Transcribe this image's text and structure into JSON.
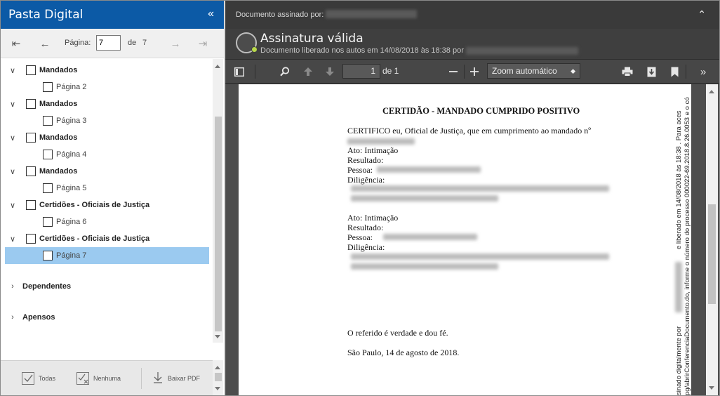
{
  "left_panel": {
    "title": "Pasta Digital",
    "collapse_icon": "double-chevron-left-icon",
    "pager": {
      "page_label": "Página:",
      "current_page": "7",
      "of_label": "de",
      "total_pages": "7"
    },
    "tree": [
      {
        "type": "group",
        "label": "Mandados"
      },
      {
        "type": "page",
        "label": "Página 2"
      },
      {
        "type": "group",
        "label": "Mandados"
      },
      {
        "type": "page",
        "label": "Página 3"
      },
      {
        "type": "group",
        "label": "Mandados"
      },
      {
        "type": "page",
        "label": "Página 4"
      },
      {
        "type": "group",
        "label": "Mandados"
      },
      {
        "type": "page",
        "label": "Página 5"
      },
      {
        "type": "group",
        "label": "Certidões - Oficiais de Justiça"
      },
      {
        "type": "page",
        "label": "Página 6"
      },
      {
        "type": "group",
        "label": "Certidões - Oficiais de Justiça"
      },
      {
        "type": "page",
        "label": "Página 7",
        "selected": true
      }
    ],
    "sections": [
      {
        "label": "Dependentes"
      },
      {
        "label": "Apensos"
      }
    ],
    "footer": {
      "all_label": "Todas",
      "none_label": "Nenhuma",
      "download_label": "Baixar PDF"
    }
  },
  "signature": {
    "signed_by_label": "Documento assinado por:",
    "status_title": "Assinatura válida",
    "released_text": "Documento liberado nos autos em 14/08/2018 às 18:38 por"
  },
  "viewer_toolbar": {
    "page_value": "1",
    "of_text": "de 1",
    "zoom_label": "Zoom automático"
  },
  "document": {
    "title": "CERTIDÃO - MANDADO CUMPRIDO POSITIVO",
    "intro": "CERTIFICO eu, Oficial de Justiça, que em cumprimento ao mandado nº",
    "block1": {
      "ato": "Ato: Intimação",
      "resultado": "Resultado:",
      "pessoa": "Pessoa:",
      "diligencia": "Diligência:"
    },
    "block2": {
      "ato": "Ato: Intimação",
      "resultado": "Resultado:",
      "pessoa": "Pessoa:",
      "diligencia": "Diligência:"
    },
    "closing": "O referido é verdade e dou fé.",
    "place_date": "São Paulo, 14 de agosto de 2018.",
    "side_line1": "sinado digitalmente por",
    "side_line1b": "e liberado em 14/08/2018 às 18:38 . Para aces",
    "side_line2": "pg/abrirConferenciaDocumento.do, informe o número do processo 000022-69.2018.8.26.0053 e o có"
  }
}
